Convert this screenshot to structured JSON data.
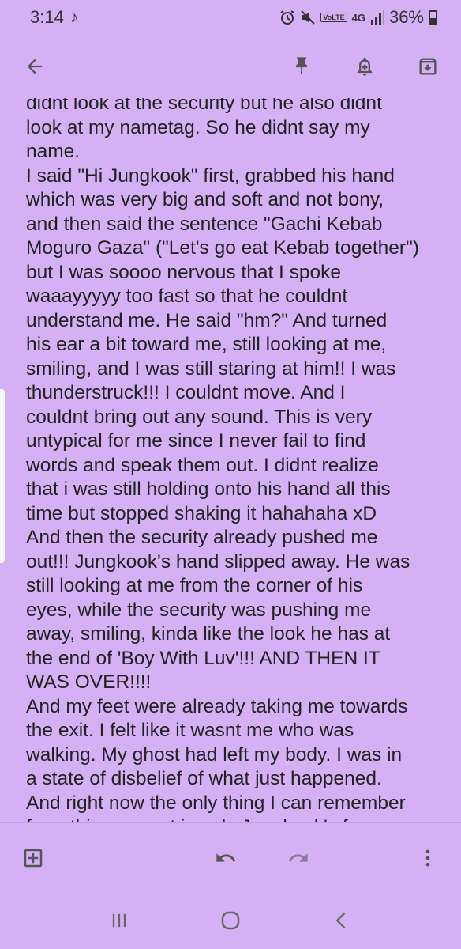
{
  "status_bar": {
    "time": "3:14",
    "network": "4G",
    "volte": "VoLTE",
    "battery": "36%"
  },
  "icons": {
    "back": "arrow-left-icon",
    "pin": "pin-icon",
    "reminder": "bell-plus-icon",
    "archive": "archive-icon",
    "add": "plus-box-icon",
    "undo": "undo-icon",
    "redo": "redo-icon",
    "more": "more-vert-icon"
  },
  "colors": {
    "note_background": "#d5b0f4",
    "text": "#222222",
    "icon": "#555555"
  },
  "note": {
    "lines": [
      "didnt look at the security but he also didnt",
      "look at my nametag. So he didnt say my",
      "name.",
      "I said \"Hi Jungkook\" first, grabbed his hand",
      "which was very big and soft and not bony,",
      "and then said the sentence \"Gachi Kebab",
      "Moguro Gaza\" (\"Let's go eat Kebab together\")",
      "but I was soooo nervous that I spoke",
      "waaayyyyy too fast so that he couldnt",
      "understand me. He said \"hm?\" And turned",
      "his ear a bit toward me, still looking at me,",
      "smiling, and I was still staring at him!! I was",
      "thunderstruck!!! I couldnt move. And I",
      "couldnt bring out any sound. This is very",
      "untypical for me since I never fail to find",
      "words and speak them out. I didnt realize",
      "that i was still holding onto his hand all this",
      "time but stopped shaking it hahahaha xD",
      "And then the security already pushed me",
      "out!!! Jungkook's hand slipped away. He was",
      "still looking at me from the corner of his",
      "eyes, while the security was pushing me",
      "away, smiling, kinda like the look he has at",
      "the end of 'Boy With Luv'!!! AND THEN IT",
      "WAS OVER!!!!",
      "And my feet were already taking me towards",
      "the exit. I felt like it wasnt me who was",
      "walking. My ghost had left my body. I was in",
      "a state of disbelief of what just happened.",
      "And right now the only thing I can remember",
      "from this moment is only Jungkook's face"
    ]
  }
}
